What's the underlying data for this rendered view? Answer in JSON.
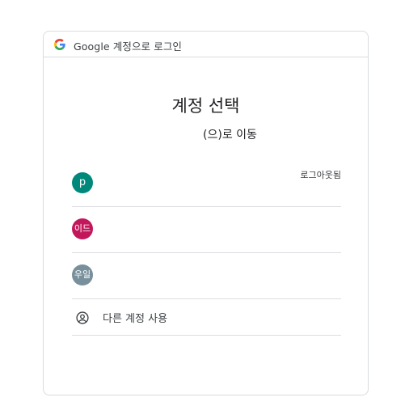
{
  "header": {
    "logo_icon": "google-g-icon",
    "text": "Google 계정으로 로그인"
  },
  "title": "계정 선택",
  "subtitle": {
    "prefix": "",
    "suffix": "(으)로 이동"
  },
  "accounts": [
    {
      "initial": "p",
      "color": "#00897b",
      "status": "로그아웃됨"
    },
    {
      "initial": "이드",
      "color": "#c2185b",
      "status": ""
    },
    {
      "initial": "우일",
      "color": "#78909c",
      "status": ""
    }
  ],
  "other_account": {
    "icon": "account-circle-icon",
    "label": "다른 계정 사용"
  }
}
